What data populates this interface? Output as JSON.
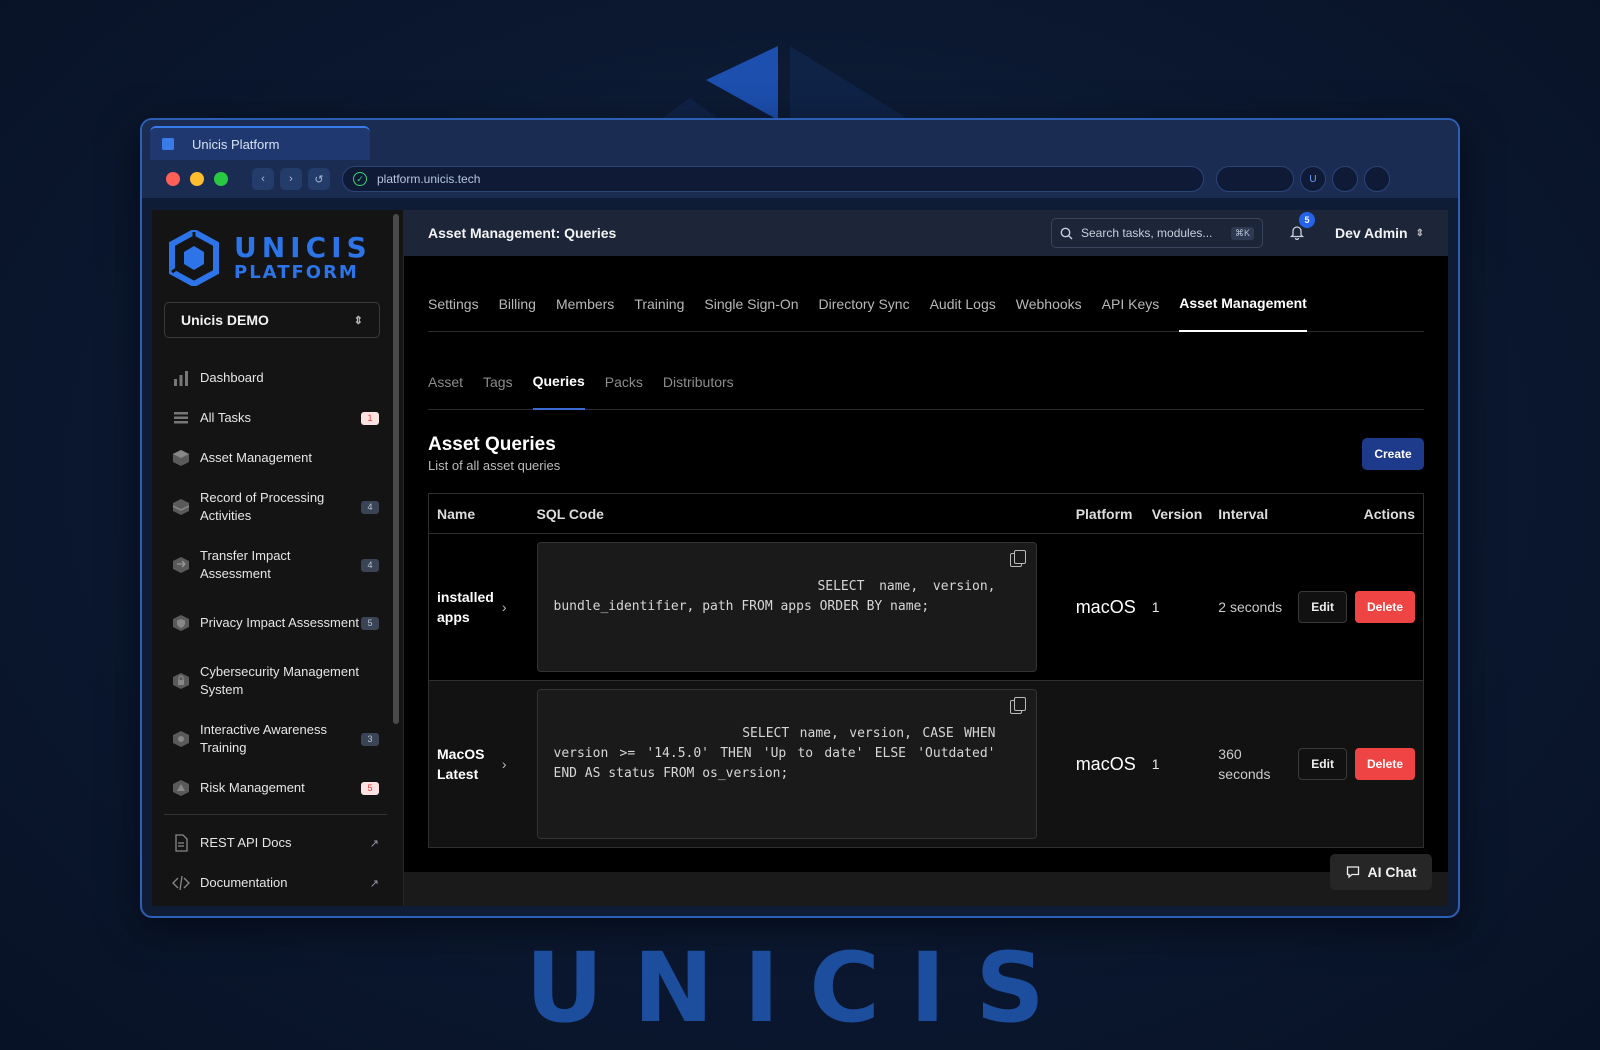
{
  "browser": {
    "tab_title": "Unicis Platform",
    "url": "platform.unicis.tech",
    "avatar_initial": "U"
  },
  "brand": {
    "logo_line1": "UNICIS",
    "logo_line2": "PLATFORM",
    "footer_wordmark": "UNICIS",
    "accent": "#2c74e8"
  },
  "sidebar": {
    "org_name": "Unicis DEMO",
    "items": [
      {
        "label": "Dashboard",
        "icon": "bar-chart-icon",
        "badge": ""
      },
      {
        "label": "All Tasks",
        "icon": "list-icon",
        "badge": "1",
        "badge_style": "red"
      },
      {
        "label": "Asset Management",
        "icon": "cube-icon",
        "badge": ""
      },
      {
        "label": "Record of Processing Activities",
        "icon": "layers-icon",
        "badge": "4",
        "badge_style": "gray"
      },
      {
        "label": "Transfer Impact Assessment",
        "icon": "transfer-icon",
        "badge": "4",
        "badge_style": "gray"
      },
      {
        "label": "Privacy Impact Assessment",
        "icon": "shield-icon",
        "badge": "5",
        "badge_style": "gray"
      },
      {
        "label": "Cybersecurity Management System",
        "icon": "lock-icon",
        "badge": ""
      },
      {
        "label": "Interactive Awareness Training",
        "icon": "training-icon",
        "badge": "3",
        "badge_style": "gray"
      },
      {
        "label": "Risk Management",
        "icon": "risk-icon",
        "badge": "5",
        "badge_style": "red"
      }
    ],
    "links": [
      {
        "label": "REST API Docs",
        "icon": "document-icon"
      },
      {
        "label": "Documentation",
        "icon": "code-icon"
      }
    ]
  },
  "header": {
    "title": "Asset Management: Queries",
    "search_placeholder": "Search tasks, modules...",
    "search_shortcut": "⌘K",
    "notifications": "5",
    "user": "Dev Admin"
  },
  "tabs": [
    "Settings",
    "Billing",
    "Members",
    "Training",
    "Single Sign-On",
    "Directory Sync",
    "Audit Logs",
    "Webhooks",
    "API Keys",
    "Asset Management"
  ],
  "active_tab": "Asset Management",
  "subtabs": [
    "Asset",
    "Tags",
    "Queries",
    "Packs",
    "Distributors"
  ],
  "active_subtab": "Queries",
  "section": {
    "title": "Asset Queries",
    "subtitle": "List of all asset queries",
    "create_label": "Create"
  },
  "table": {
    "columns": [
      "Name",
      "SQL Code",
      "Platform",
      "Version",
      "Interval",
      "Actions"
    ],
    "rows": [
      {
        "name": "installed apps",
        "sql": "SELECT name, version, bundle_identifier, path FROM apps ORDER BY name;",
        "platform": "macOS",
        "version": "1",
        "interval": "2 seconds"
      },
      {
        "name": "MacOS Latest",
        "sql": "SELECT name, version, CASE WHEN version >= '14.5.0' THEN 'Up to date' ELSE 'Outdated' END AS status FROM os_version;",
        "platform": "macOS",
        "version": "1",
        "interval": "360 seconds"
      }
    ],
    "edit_label": "Edit",
    "delete_label": "Delete"
  },
  "ai_chat_label": "AI Chat"
}
